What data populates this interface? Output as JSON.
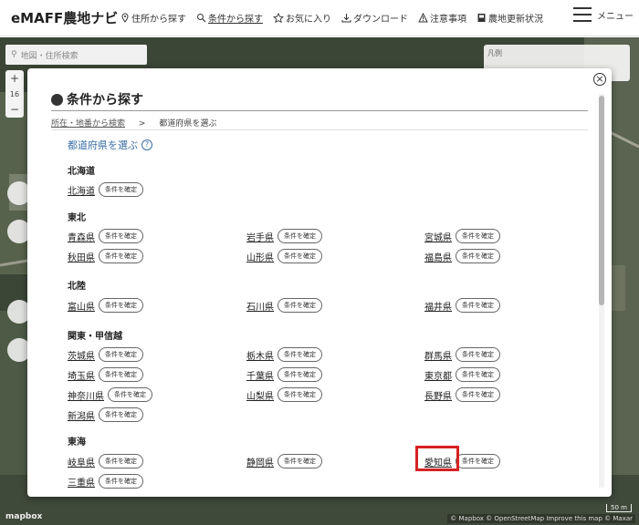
{
  "app": {
    "logo": "eMAFF農地ナビ"
  },
  "nav": {
    "items": [
      {
        "label": "住所から探す",
        "icon": "pin-icon"
      },
      {
        "label": "条件から探す",
        "icon": "filter-search-icon",
        "active": true
      },
      {
        "label": "お気に入り",
        "icon": "star-icon"
      },
      {
        "label": "ダウンロード",
        "icon": "download-icon"
      },
      {
        "label": "注意事項",
        "icon": "warning-icon"
      },
      {
        "label": "農地更新状況",
        "icon": "book-icon"
      }
    ],
    "menu_label": "メニュー"
  },
  "map": {
    "search_placeholder": "地図・住所検索",
    "zoom_level": "16",
    "legend_title": "凡例",
    "mapbox_logo": "mapbox",
    "attribution": "© Mapbox © OpenStreetMap Improve this map © Maxar",
    "scale": "50 m"
  },
  "modal": {
    "title": "条件から探す",
    "breadcrumb": {
      "link": "所在・地番から検索",
      "separator": ">",
      "current": "都道府県を選ぶ"
    },
    "heading": "都道府県を選ぶ",
    "help": "?",
    "confirm_label": "条件を確定",
    "regions": [
      {
        "name": "北海道",
        "prefs": [
          "北海道"
        ]
      },
      {
        "name": "東北",
        "prefs": [
          "青森県",
          "岩手県",
          "宮城県",
          "秋田県",
          "山形県",
          "福島県"
        ]
      },
      {
        "name": "北陸",
        "prefs": [
          "富山県",
          "石川県",
          "福井県"
        ]
      },
      {
        "name": "関東・甲信越",
        "prefs": [
          "茨城県",
          "栃木県",
          "群馬県",
          "埼玉県",
          "千葉県",
          "東京都",
          "神奈川県",
          "山梨県",
          "長野県",
          "新潟県"
        ]
      },
      {
        "name": "東海",
        "prefs": [
          "岐阜県",
          "静岡県",
          "愛知県",
          "三重県"
        ]
      }
    ],
    "highlighted": "愛知県"
  },
  "colors": {
    "link_blue": "#3a6ea5",
    "highlight_red": "#d62222"
  }
}
